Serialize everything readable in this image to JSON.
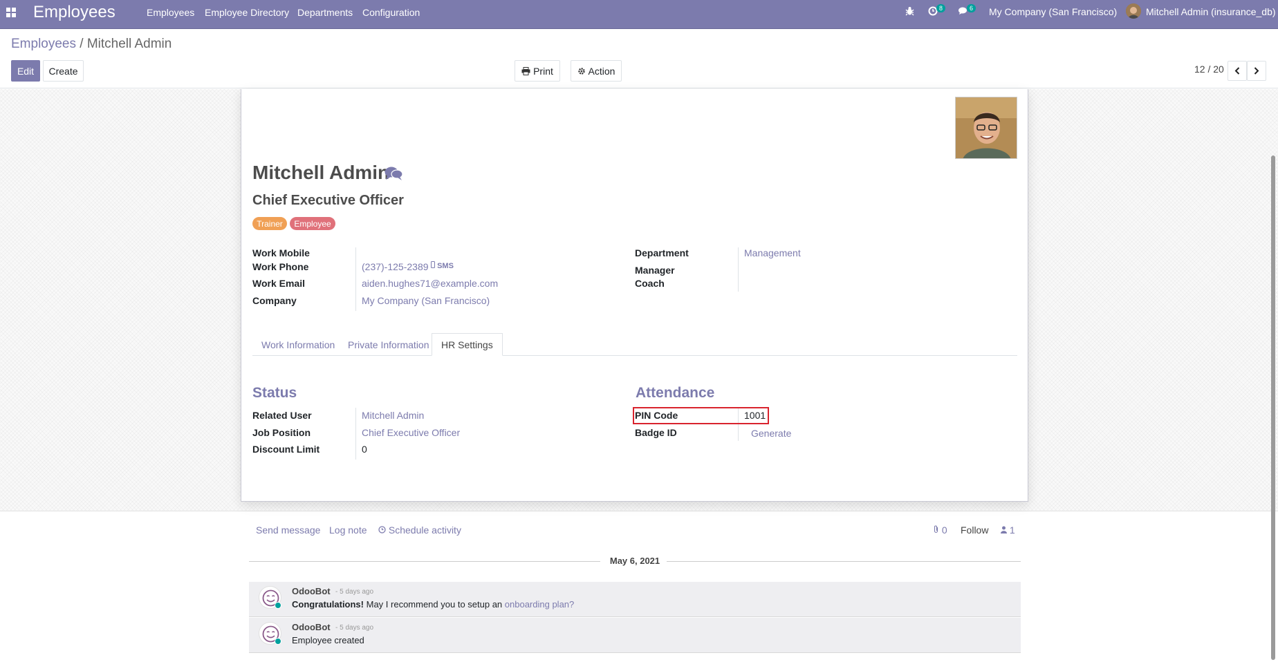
{
  "navbar": {
    "app_name": "Employees",
    "menu": [
      "Employees",
      "Employee Directory",
      "Departments",
      "Configuration"
    ],
    "activity_count": "8",
    "message_count": "6",
    "company": "My Company (San Francisco)",
    "user": "Mitchell Admin (insurance_db)"
  },
  "breadcrumb": {
    "parent": "Employees",
    "separator": "/",
    "current": "Mitchell Admin"
  },
  "toolbar": {
    "edit": "Edit",
    "create": "Create",
    "print": "Print",
    "action": "Action",
    "pager": "12 / 20"
  },
  "employee": {
    "name": "Mitchell Admin",
    "job_title": "Chief Executive Officer",
    "tags": [
      {
        "label": "Trainer",
        "color": "#F0A055"
      },
      {
        "label": "Employee",
        "color": "#E0717A"
      }
    ]
  },
  "contact": {
    "work_mobile_label": "Work Mobile",
    "work_phone_label": "Work Phone",
    "work_phone": "(237)-125-2389",
    "sms": "SMS",
    "work_email_label": "Work Email",
    "work_email": "aiden.hughes71@example.com",
    "company_label": "Company",
    "company": "My Company (San Francisco)",
    "department_label": "Department",
    "department": "Management",
    "manager_label": "Manager",
    "coach_label": "Coach"
  },
  "tabs": [
    "Work Information",
    "Private Information",
    "HR Settings"
  ],
  "status": {
    "title": "Status",
    "related_user_label": "Related User",
    "related_user": "Mitchell Admin",
    "job_position_label": "Job Position",
    "job_position": "Chief Executive Officer",
    "discount_limit_label": "Discount Limit",
    "discount_limit": "0"
  },
  "attendance": {
    "title": "Attendance",
    "pin_code_label": "PIN Code",
    "pin_code": "1001",
    "badge_id_label": "Badge ID",
    "generate": "Generate"
  },
  "chatter": {
    "send_message": "Send message",
    "log_note": "Log note",
    "schedule_activity": "Schedule activity",
    "attachments": "0",
    "follow": "Follow",
    "followers": "1",
    "date": "May 6, 2021",
    "messages": [
      {
        "author": "OdooBot",
        "time": "- 5 days ago",
        "bold": "Congratulations!",
        "text": " May I recommend you to setup an ",
        "link": "onboarding plan?"
      },
      {
        "author": "OdooBot",
        "time": "- 5 days ago",
        "text": "Employee created"
      }
    ]
  },
  "colors": {
    "brand": "#7C7BAD",
    "highlight": "#D9232D",
    "teal": "#00A09D"
  }
}
